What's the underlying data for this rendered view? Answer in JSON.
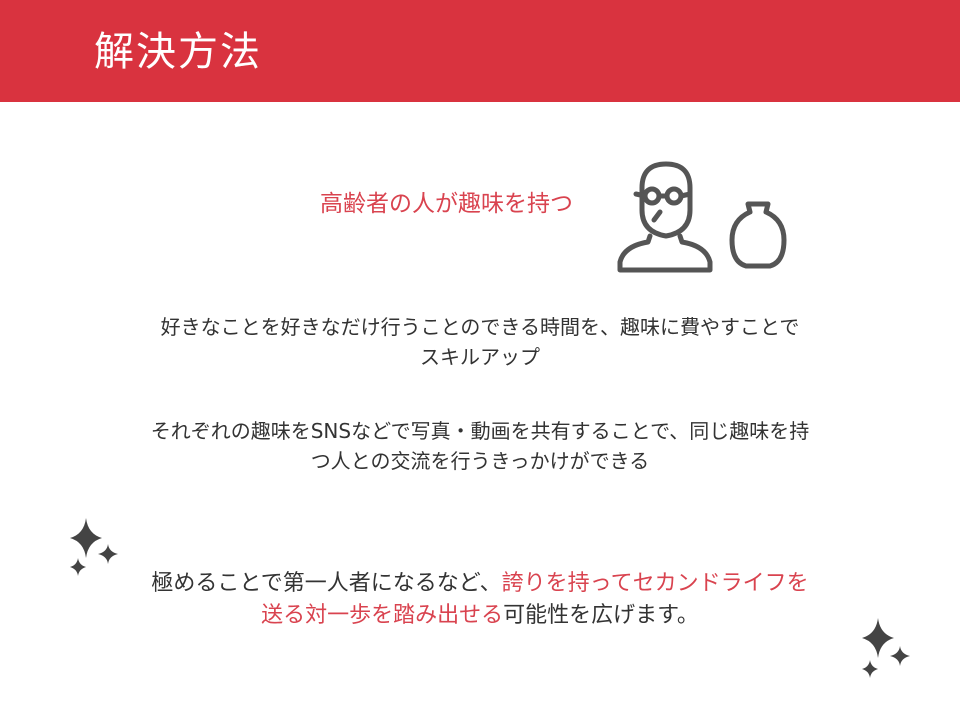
{
  "title": "解決方法",
  "subtitle": "高齢者の人が趣味を持つ",
  "paragraph1": {
    "line1": "好きなことを好きなだけ行うことのできる時間を、趣味に費やすことで",
    "line2": "スキルアップ"
  },
  "paragraph2": {
    "line1": "それぞれの趣味をSNSなどで写真・動画を共有することで、同じ趣味を持",
    "line2": "つ人との交流を行うきっかけができる"
  },
  "paragraph3": {
    "line1_plain": "極めることで第一人者になるなど、",
    "line1_accent": "誇りを持ってセカンドライフを",
    "line2_accent": "送る対一歩を踏み出せる",
    "line2_plain": "可能性を広げます。"
  },
  "colors": {
    "header": "#d9333f",
    "accent": "#d9434f",
    "icon": "#555555"
  },
  "icons": [
    "person-with-glasses-icon",
    "vase-icon",
    "sparkle-icon"
  ]
}
